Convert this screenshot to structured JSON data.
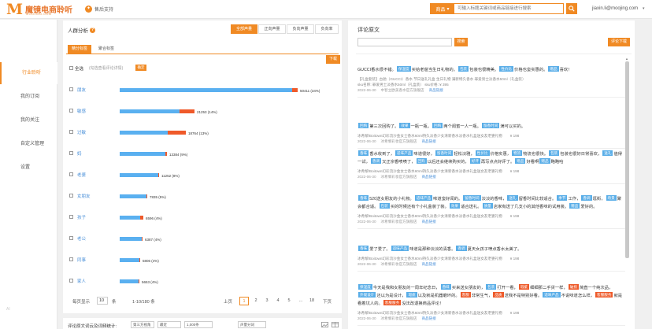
{
  "header": {
    "logo_text": "魔镜电商聆听",
    "logo_sub": "MOOJING.COM",
    "support_label": "售后支持",
    "search_type": "商品",
    "search_placeholder": "可输入标题关键词或商品链接进行搜索",
    "user": "jiaxin.li@moojing.com"
  },
  "sidebar": {
    "items": [
      {
        "label": "行业聆听",
        "active": true
      },
      {
        "label": "我的订阅",
        "active": false
      },
      {
        "label": "我的关注",
        "active": false
      },
      {
        "label": "自定义管理",
        "active": false
      },
      {
        "label": "设置",
        "active": false
      }
    ],
    "bottom": "AI"
  },
  "left": {
    "title": "人群分析",
    "seg_tabs": [
      "全部声量",
      "正向声量",
      "负向声量",
      "负向率"
    ],
    "sub_tabs": [
      "精分标签",
      "聚合标签"
    ],
    "download": "下载",
    "select_all": "全选",
    "select_hint": "(勾选查看评论详情)",
    "confirm": "确定",
    "bars": [
      {
        "label": "朋友",
        "pos": 90,
        "neg": 3,
        "value": "50411 (34%)"
      },
      {
        "label": "敏感",
        "pos": 80,
        "neg": 20,
        "value": "21253 (14%)"
      },
      {
        "label": "过敏",
        "pos": 73,
        "neg": 27,
        "value": "18764 (13%)"
      },
      {
        "label": "妈",
        "pos": 97,
        "neg": 3,
        "value": "13384 (9%)"
      },
      {
        "label": "老婆",
        "pos": 97,
        "neg": 3,
        "value": "11252 (8%)"
      },
      {
        "label": "女朋友",
        "pos": 98,
        "neg": 2,
        "value": "7835 (5%)"
      },
      {
        "label": "孩子",
        "pos": 86,
        "neg": 14,
        "value": "6596 (4%)"
      },
      {
        "label": "老公",
        "pos": 97,
        "neg": 3,
        "value": "6387 (4%)"
      },
      {
        "label": "同事",
        "pos": 98,
        "neg": 2,
        "value": "5806 (4%)"
      },
      {
        "label": "家人",
        "pos": 97,
        "neg": 3,
        "value": "5653 (4%)"
      }
    ],
    "max_value": 50411,
    "pager": {
      "per_page_label": "每页显示",
      "per_page": "10",
      "unit": "条",
      "range": "1-10/180 条",
      "prev": "上页",
      "pages": [
        "1",
        "2",
        "3",
        "4",
        "5",
        "...",
        "18"
      ],
      "next": "下页"
    },
    "bottom": {
      "title": "评论原文词云及词频统计:",
      "selects": [
        "第三方视角",
        "最近",
        "1,000条",
        "声量分词"
      ]
    }
  },
  "right": {
    "title": "评论原文",
    "search_btn": "搜索",
    "download": "评论下载",
    "reviews": [
      {
        "segments": [
          [
            "t",
            "GUCCI香水很不错。"
          ],
          [
            "b",
            "保湿度"
          ],
          [
            "t",
            "买给老爸当生日礼物的。"
          ],
          [
            "b",
            "包装"
          ],
          [
            "t",
            "包装也很精美。"
          ],
          [
            "b",
            "性价比"
          ],
          [
            "t",
            "价格也蛮实惠的。"
          ],
          [
            "b",
            "赠品"
          ],
          [
            "t",
            "喜欢！"
          ]
        ],
        "meta": "【礼盒套装】古驰（GUCCI）香水 节日送礼礼盒 生日礼物 满新特久香水 罪爱男士淡香水50ml（礼盒装）",
        "meta2": "sku名称: 罪爱男士淡香水50ml（礼盒装） sku价格: ¥ 395",
        "date": "2022-06-30",
        "shop": "中智立欧美香水官方旗舰店",
        "link": "商品链接",
        "price": ""
      },
      {
        "segments": [
          [
            "b",
            "回购"
          ],
          [
            "t",
            "第三次回购了。"
          ],
          [
            "b",
            "效果"
          ],
          [
            "t",
            "一瓶一瓶。"
          ],
          [
            "b",
            "回购"
          ],
          [
            "t",
            "两个闺蜜一人一瓶。"
          ],
          [
            "b",
            "留香时间"
          ],
          [
            "t",
            "满可以买的。"
          ]
        ],
        "meta": "冰希黎/Boitown幻彩流沙金女士香水60ml持久淡香少女清新香水淡香水礼盒送女友老婆礼物",
        "meta2": "",
        "date": "2022-06-30",
        "shop": "冰希黎彩妆官方旗舰店",
        "link": "商品链接",
        "price": "¥ 198"
      },
      {
        "segments": [
          [
            "b",
            "香味"
          ],
          [
            "t",
            "香水收到了，"
          ],
          [
            "b",
            "适味产品"
          ],
          [
            "t",
            "味道很好，"
          ],
          [
            "b",
            "留香时间"
          ],
          [
            "t",
            "轻松淡雅，"
          ],
          [
            "b",
            "性价比"
          ],
          [
            "t",
            "价格实惠，"
          ],
          [
            "b",
            "物流"
          ],
          [
            "t",
            "物流也很快。"
          ],
          [
            "b",
            "包装"
          ],
          [
            "t",
            "包装也很好日常喜欢，"
          ],
          [
            "b",
            "送礼"
          ],
          [
            "t",
            "值得一试，"
          ],
          [
            "b",
            "香调"
          ],
          [
            "t",
            "又正宗香喷喷了，"
          ],
          [
            "b",
            "回购"
          ],
          [
            "t",
            "以后还会继续购买的，"
          ],
          [
            "b",
            "好评"
          ],
          [
            "t",
            "再写点点好评了。"
          ],
          [
            "b",
            "赠品"
          ],
          [
            "t",
            "好看啊"
          ],
          [
            "b",
            "赠品"
          ],
          [
            "t",
            "略略哈"
          ]
        ],
        "meta": "冰希黎/Boitown幻彩流沙金女士香水60ml持久淡香少女清新香水淡香水礼盒送女友老婆礼物",
        "meta2": "",
        "date": "2022-06-30",
        "shop": "冰希黎彩妆官方旗舰店",
        "link": "商品链接",
        "price": "¥ 198"
      },
      {
        "segments": [
          [
            "b",
            "香味"
          ],
          [
            "t",
            "520送女朋友的小礼物。"
          ],
          [
            "b",
            "适味产品"
          ],
          [
            "t",
            "味道蛮好闻的。"
          ],
          [
            "b",
            "留香时间"
          ],
          [
            "t",
            "淡淡的香味，"
          ],
          [
            "b",
            "送礼"
          ],
          [
            "t",
            "留香时间比较适合。"
          ],
          [
            "b",
            "季节"
          ],
          [
            "t",
            "工作，"
          ],
          [
            "b",
            "香调"
          ],
          [
            "t",
            "逛街，"
          ],
          [
            "b",
            "场景"
          ],
          [
            "t",
            "聚会都合适。"
          ],
          [
            "b",
            "包装"
          ],
          [
            "t",
            "买的时候还有个小礼盒装了装。"
          ],
          [
            "b",
            "效果"
          ],
          [
            "t",
            "适合送礼。"
          ],
          [
            "b",
            "质量"
          ],
          [
            "t",
            "店家有送了几支小的其他香味的试用装。"
          ],
          [
            "b",
            "赠品"
          ],
          [
            "t",
            "爱好的。"
          ]
        ],
        "meta": "冰希黎/Boitown幻彩流沙金女士香水60ml持久淡香少女清新香水淡香水礼盒送女友老婆礼物",
        "meta2": "",
        "date": "2022-06-30",
        "shop": "冰希黎彩妆官方旗舰店",
        "link": "商品链接",
        "price": "¥ 198"
      },
      {
        "segments": [
          [
            "b",
            "香味"
          ],
          [
            "t",
            "爱了爱了。"
          ],
          [
            "b",
            "适味产品"
          ],
          [
            "t",
            "味道是那种淡淡的清香。"
          ],
          [
            "b",
            "香调"
          ],
          [
            "t",
            "夏天女孩子喷点香水太美了。"
          ]
        ],
        "meta": "冰希黎/Boitown幻彩流沙金女士香水60ml持久淡香少女清新香水淡香水礼盒送女友老婆礼物",
        "meta2": "",
        "date": "2022-06-30",
        "shop": "冰希黎彩妆官方旗舰店",
        "link": "商品链接",
        "price": "¥ 198"
      },
      {
        "segments": [
          [
            "b",
            "保湿度"
          ],
          [
            "t",
            "今天是我和女朋友的一周年纪念日，"
          ],
          [
            "b",
            "香味"
          ],
          [
            "t",
            "买来送女朋友的，"
          ],
          [
            "b",
            "包装"
          ],
          [
            "t",
            "打开一看，"
          ],
          [
            "r",
            "瑕疵"
          ],
          [
            "t",
            "细细那二手货一样，"
          ],
          [
            "r",
            "破损"
          ],
          [
            "t",
            "简直一个纯次品，"
          ],
          [
            "b",
            "外观设计"
          ],
          [
            "t",
            "还以为是设计，"
          ],
          [
            "b",
            "瑕疵"
          ],
          [
            "t",
            "以及就是机器磨坏的。"
          ],
          [
            "r",
            "客服"
          ],
          [
            "t",
            "非常生气，"
          ],
          [
            "r",
            "品质"
          ],
          [
            "t",
            "送我不是特别好看。"
          ],
          [
            "b",
            "适味产品"
          ],
          [
            "t",
            "不说味道怎么样，"
          ],
          [
            "r",
            "客服服务"
          ],
          [
            "t",
            "就是看着坑人的。"
          ],
          [
            "r",
            "客服服务"
          ],
          [
            "t",
            "没法改退换商品评论！"
          ]
        ],
        "meta": "冰希黎/Boitown幻彩流沙金女士香水60ml持久淡香少女清新香水淡香水礼盒送女友老婆礼物",
        "meta2": "",
        "date": "2022-06-30",
        "shop": "冰希黎彩妆官方旗舰店",
        "link": "商品链接",
        "price": "¥ 198"
      }
    ]
  },
  "colors": {
    "accent": "#f08a24",
    "bar_positive": "#5ab0f0",
    "bar_negative": "#ef5a2a",
    "tag_blue": "#5aaee8",
    "tag_red": "#ee5a2a"
  }
}
